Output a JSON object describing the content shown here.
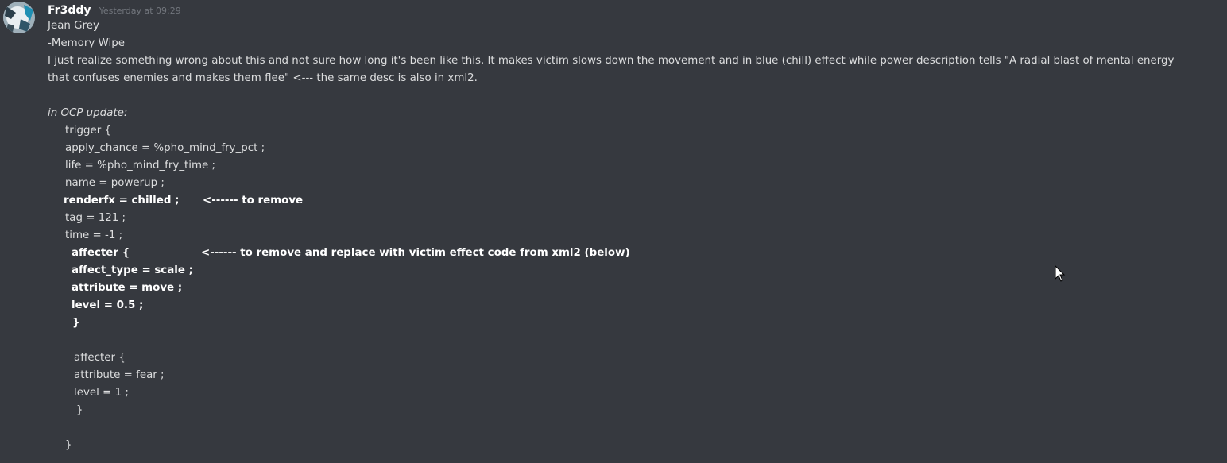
{
  "message": {
    "username": "Fr3ddy",
    "timestamp": "Yesterday at 09:29",
    "avatar_icon": "user-avatar",
    "lines": {
      "l1": "Jean Grey",
      "l2": "-Memory Wipe",
      "l3": "I just realize something wrong about this and not sure how long it's been like this. It makes victim slows down the movement and in blue (chill) effect while power description tells  \"A radial blast of mental energy that confuses enemies and makes them flee\"  <--- the same desc is also in xml2.",
      "l4": "in OCP update:",
      "l5": "trigger {",
      "l6": "apply_chance = %pho_mind_fry_pct ;",
      "l7": "life = %pho_mind_fry_time ;",
      "l8": "name = powerup ;",
      "l9": "renderfx = chilled ;",
      "l9_note": "<------ to remove",
      "l10": "tag = 121 ;",
      "l11": "time = -1 ;",
      "l12": "affecter {",
      "l12_note": "<------ to remove and replace with victim effect code from xml2 (below)",
      "l13": "affect_type = scale ;",
      "l14": "attribute = move ;",
      "l15": "level = 0.5 ;",
      "l16": "}",
      "l17": "affecter {",
      "l18": "attribute = fear ;",
      "l19": "level = 1 ;",
      "l20": "}",
      "l21": "}"
    }
  },
  "colors": {
    "background": "#36393f",
    "text": "#dcddde",
    "username": "#ffffff",
    "timestamp": "#72767d"
  }
}
